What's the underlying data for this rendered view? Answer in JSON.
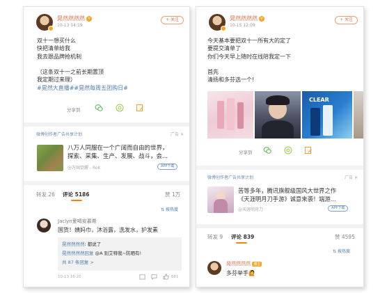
{
  "left": {
    "post": {
      "username": "晃然然然然",
      "vip_badge": "V",
      "timestamp": "10-13 14:19",
      "follow_label": "+ 关注",
      "lines": [
        "双十一想买什么",
        "快把清单给我",
        "我去跟品牌抢机制",
        "",
        "（这条双十一之前长期置顶",
        "我定期过来理）"
      ],
      "hashtags": "#晃然大直播##晃然每周五团购日#"
    },
    "actions": {
      "share_label": "分享到"
    },
    "ad": {
      "header": "微博创作者广告共享计划",
      "tag": "广告",
      "title_lines": [
        "八万人同服在一个广阔而自由的世界，",
        "探索、采集、生产、发展、战斗，会..."
      ],
      "source": "@万国觉醒 - RoK",
      "download_label": "APP下载"
    },
    "tabs": {
      "repost": "转发 26",
      "comment": "评论 5186",
      "like": "赞 1万",
      "sort": "按热度"
    },
    "comment": {
      "name": "Jaclyn爱喝安慕希",
      "text": "国货！姨妈巾，沐浴露，洗发水，护发素",
      "replies": [
        {
          "who": "晃然然然然",
          "text": ": 都说了"
        },
        {
          "who": "晃然然然然回复",
          "text": "@A 别艾特我~防晒有!"
        }
      ],
      "more": "共 87 条回复 >",
      "time": "10-13 16:20",
      "likes": "661"
    }
  },
  "right": {
    "post": {
      "username": "晃然然然然",
      "vip_badge": "V",
      "timestamp": "10-15 12:09",
      "follow_label": "+ 关注",
      "lines": [
        "今天基本要把双十一所有大的定了",
        "要提交清单了",
        "你们今天早上随时在线陪我定一下",
        "",
        "首先",
        "清扬和多芬选一个!"
      ],
      "image_caption": "CLEAR"
    },
    "actions": {
      "share_label": "分享到"
    },
    "ad": {
      "header": "微博创作者广告共享计划",
      "tag": "广告",
      "title_lines": [
        "苦等多年，腾讯旗舰级国风大世界之作",
        "《天涯明月刀手游》诚意来袭！端游..."
      ],
      "source": "@天涯明月刀",
      "download_label": "APP下载"
    },
    "tabs": {
      "repost": "转发 9",
      "comment": "评论 839",
      "like": "赞 4595",
      "sort": "按热度"
    },
    "comment": {
      "name": "晃然然然然",
      "badge": "博主",
      "text": "多芬举手🙋"
    }
  },
  "colors": {
    "accent": "#ff8200",
    "link": "#507daf",
    "username": "#eb7350"
  }
}
